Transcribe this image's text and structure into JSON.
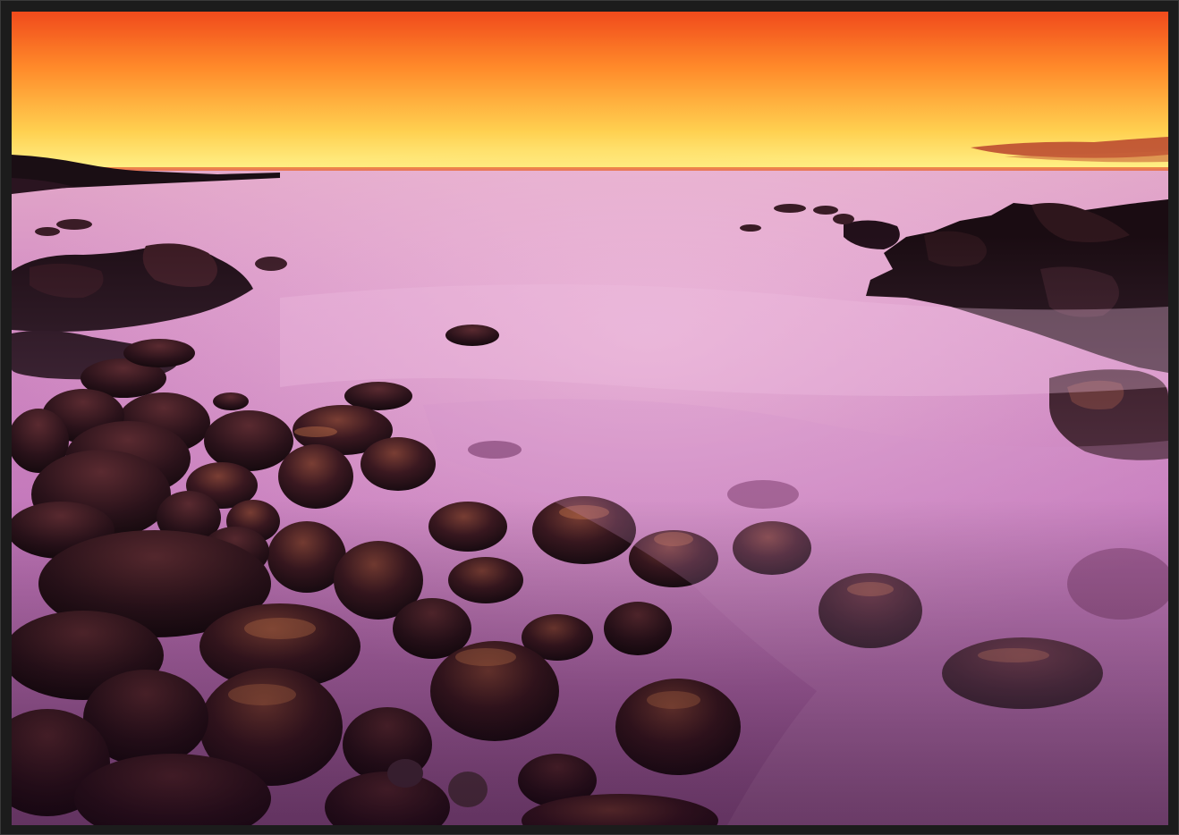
{
  "frame": {
    "border_color": "#1c1c1c"
  },
  "scene": {
    "sky_top": "#f2521c",
    "sky_mid": "#ff9a2a",
    "sky_glow": "#fff27a",
    "horizon_glow": "#ffe07a",
    "sea_top": "#d896c8",
    "sea_mid": "#c86fb8",
    "sea_bottom": "#7a2f7c",
    "rock_dark": "#1c0e14",
    "rock_mid": "#3b1a22",
    "rock_light": "#8a4a3c",
    "cloud": "#b8442e"
  }
}
